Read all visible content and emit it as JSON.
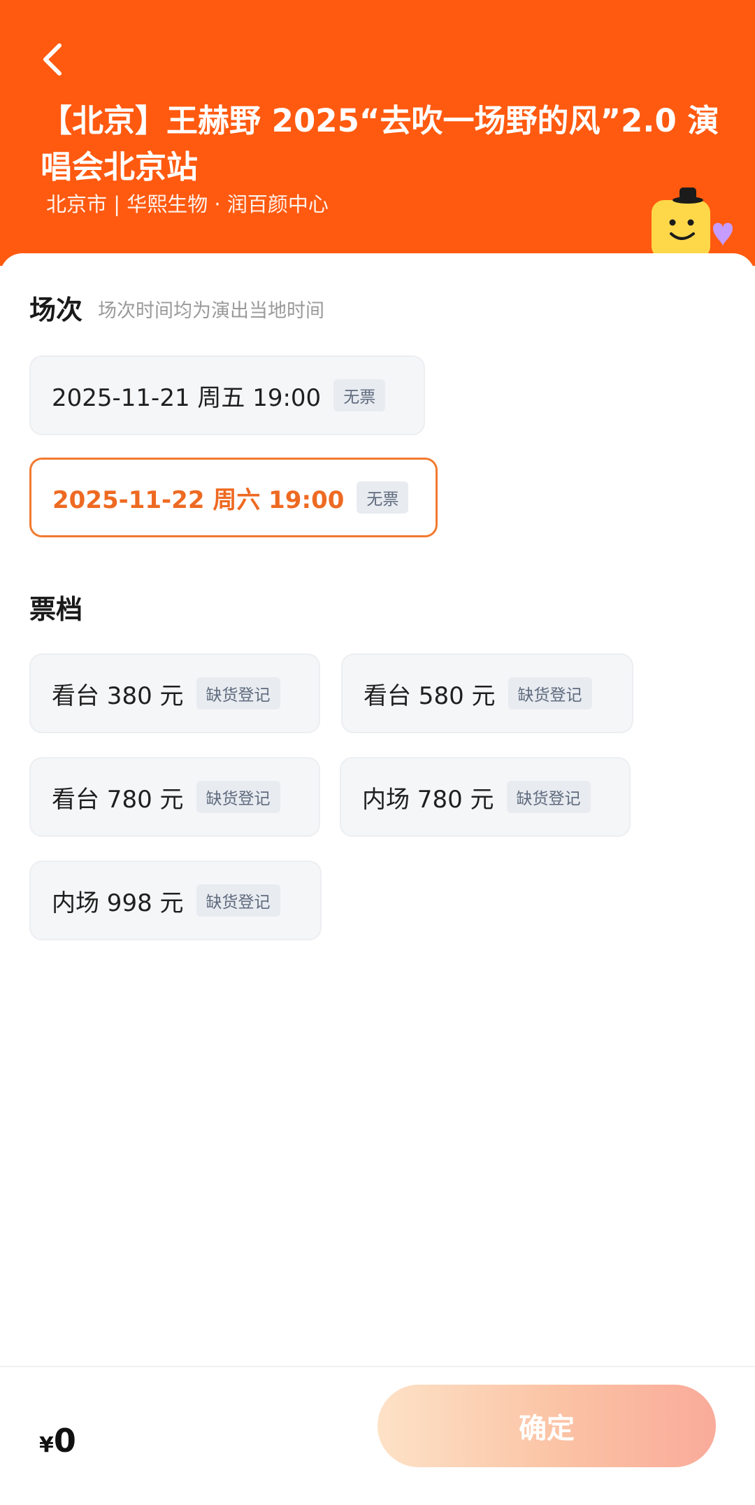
{
  "header": {
    "title": "【北京】王赫野 2025“去吹一场野的风”2.0 演唱会北京站",
    "subtitle": "北京市 | 华熙生物 · 润百颜中心",
    "bg_color": "#ff5a10"
  },
  "sessions": {
    "label": "场次",
    "hint": "场次时间均为演出当地时间",
    "items": [
      {
        "label": "2025-11-21 周五 19:00",
        "tag": "无票",
        "selected": false
      },
      {
        "label": "2025-11-22 周六 19:00",
        "tag": "无票",
        "selected": true
      }
    ]
  },
  "tiers": {
    "label": "票档",
    "items": [
      {
        "label": "看台 380 元",
        "tag": "缺货登记"
      },
      {
        "label": "看台 580 元",
        "tag": "缺货登记"
      },
      {
        "label": "看台 780 元",
        "tag": "缺货登记"
      },
      {
        "label": "内场 780 元",
        "tag": "缺货登记"
      },
      {
        "label": "内场 998 元",
        "tag": "缺货登记"
      }
    ]
  },
  "footer": {
    "currency": "¥",
    "price": "0",
    "confirm_label": "确定"
  },
  "colors": {
    "accent": "#ff5a10",
    "selected": "#ee6a22"
  },
  "icons": {
    "back": "chevron-left-icon",
    "mascot": "mascot-sticker"
  }
}
